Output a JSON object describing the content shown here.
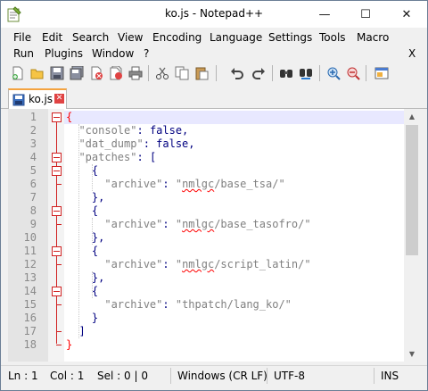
{
  "window": {
    "title": "ko.js - Notepad++",
    "controls": {
      "minimize": "—",
      "maximize": "☐",
      "close": "✕"
    }
  },
  "menu": {
    "row1": [
      "File",
      "Edit",
      "Search",
      "View",
      "Encoding",
      "Language",
      "Settings",
      "Tools",
      "Macro"
    ],
    "row2": [
      "Run",
      "Plugins",
      "Window",
      "?"
    ],
    "close_doc": "X"
  },
  "toolbar": {
    "buttons": [
      "new-file",
      "open-file",
      "save",
      "save-all",
      "close",
      "close-all",
      "print",
      "cut",
      "copy",
      "paste",
      "undo",
      "redo",
      "find",
      "replace",
      "zoom-in",
      "zoom-out",
      "sync-scroll"
    ]
  },
  "tabs": [
    {
      "label": "ko.js",
      "active": true
    }
  ],
  "editor": {
    "line_numbers": [
      "1",
      "2",
      "3",
      "4",
      "5",
      "6",
      "7",
      "8",
      "9",
      "10",
      "11",
      "12",
      "13",
      "14",
      "15",
      "16",
      "17",
      "18"
    ],
    "current_line": 1,
    "lines": [
      "{",
      "  \"console\": false,",
      "  \"dat_dump\": false,",
      "  \"patches\": [",
      "    {",
      "      \"archive\": \"nmlgc/base_tsa/\"",
      "    },",
      "    {",
      "      \"archive\": \"nmlgc/base_tasofro/\"",
      "    },",
      "    {",
      "      \"archive\": \"nmlgc/script_latin/\"",
      "    },",
      "    {",
      "      \"archive\": \"thpatch/lang_ko/\"",
      "    }",
      "  ]",
      "}"
    ]
  },
  "status": {
    "line": "Ln : 1",
    "col": "Col : 1",
    "sel": "Sel : 0 | 0",
    "eol": "Windows (CR LF)",
    "encoding": "UTF-8",
    "mode": "INS"
  },
  "colors": {
    "keyword": "#000080",
    "string": "#808080",
    "brace_highlight": "#ff0000",
    "current_line": "#e8e8ff",
    "tab_accent": "#f4a340"
  }
}
